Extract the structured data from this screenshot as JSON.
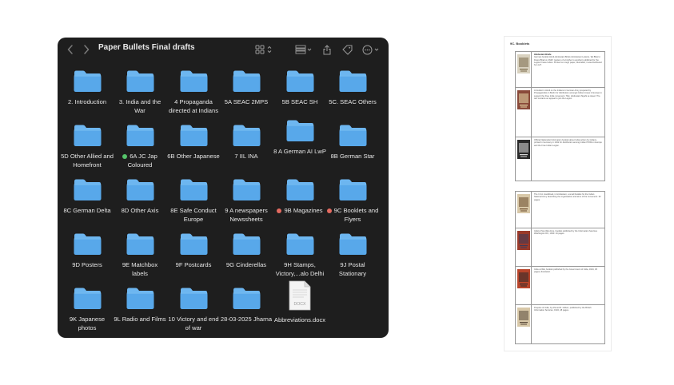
{
  "window": {
    "title": "Paper Bullets Final drafts"
  },
  "colors": {
    "folder_top": "#6db6f0",
    "folder_body": "#58a8ea",
    "window_bg": "#1e1e1e",
    "tag_green": "#55c46a",
    "tag_red": "#e36a60"
  },
  "toolbar": {
    "back_icon": "chevron-left-icon",
    "forward_icon": "chevron-right-icon",
    "view_icon": "grid-view-icon",
    "group_icon": "group-by-icon",
    "share_icon": "share-icon",
    "tag_icon": "tag-icon",
    "more_icon": "more-icon"
  },
  "items": [
    {
      "label": "2. Introduction",
      "type": "folder",
      "tag": ""
    },
    {
      "label": "3. India and the War",
      "type": "folder",
      "tag": ""
    },
    {
      "label": "4 Propaganda directed at Indians",
      "type": "folder",
      "tag": ""
    },
    {
      "label": "5A SEAC 2MPS",
      "type": "folder",
      "tag": ""
    },
    {
      "label": "5B SEAC SH",
      "type": "folder",
      "tag": ""
    },
    {
      "label": "5C. SEAC Others",
      "type": "folder",
      "tag": ""
    },
    {
      "label": "5D Other Allied and Homefront",
      "type": "folder",
      "tag": ""
    },
    {
      "label": "6A JC Jap Coloured",
      "type": "folder",
      "tag": "green"
    },
    {
      "label": "6B Other Japanese",
      "type": "folder",
      "tag": ""
    },
    {
      "label": "7 IIL INA",
      "type": "folder",
      "tag": ""
    },
    {
      "label": "8 A German AI LwP",
      "type": "folder",
      "tag": ""
    },
    {
      "label": "8B German Star",
      "type": "folder",
      "tag": ""
    },
    {
      "label": "8C German Delta",
      "type": "folder",
      "tag": ""
    },
    {
      "label": "8D Other Axis",
      "type": "folder",
      "tag": ""
    },
    {
      "label": "8E Safe Conduct Europe",
      "type": "folder",
      "tag": ""
    },
    {
      "label": "9 A newspapers Newssheets",
      "type": "folder",
      "tag": ""
    },
    {
      "label": "9B Magazines",
      "type": "folder",
      "tag": "red"
    },
    {
      "label": "9C Booklets and Flyers",
      "type": "folder",
      "tag": "red"
    },
    {
      "label": "9D Posters",
      "type": "folder",
      "tag": ""
    },
    {
      "label": "9E Matchbox labels",
      "type": "folder",
      "tag": ""
    },
    {
      "label": "9F Postcards",
      "type": "folder",
      "tag": ""
    },
    {
      "label": "9G Cinderellas",
      "type": "folder",
      "tag": ""
    },
    {
      "label": "9H Stamps, Victory,...alo Delhi",
      "type": "folder",
      "tag": ""
    },
    {
      "label": "9J Postal Stationary",
      "type": "folder",
      "tag": ""
    },
    {
      "label": "9K Japanese photos",
      "type": "folder",
      "tag": ""
    },
    {
      "label": "9L Radio and Films",
      "type": "folder",
      "tag": ""
    },
    {
      "label": "10 Victory and end of war",
      "type": "folder",
      "tag": ""
    },
    {
      "label": "28-03-2025 Jharna",
      "type": "folder",
      "tag": ""
    },
    {
      "label": "Abbreviations.docx",
      "type": "docx",
      "tag": "",
      "badge": "DOCX"
    }
  ],
  "doc_preview": {
    "heading": "9C. Booklets",
    "rows_top": [
      {
        "title": "Hindustani Briefe",
        "text": "German booklet Hindi-Hindustani Briefe (Hindustani Letters), 'Ek Bhai ki Dusre Bhai ko Chithi' (Letters of a brother to another) published for the Legion Freies Indien. Printed on rough paper, illustrated, it was distributed by Lw.P.",
        "highlight": ""
      },
      {
        "title": "",
        "text": "A booklet in Hindi on the Indians in German Army prepared by Propagandists in Berlin for distribution amongst Indian troops in Europe to support the Free India movement. Title: Hindustani Sipahi se Apeel. The text contains an appeal to join the Legion.",
        "highlight": ""
      },
      {
        "title": "",
        "text": "Official Nationalist Information booklet about India written by Indians, printed in Germany in 1942 for distribution among Indian POWs in Europe and the Free Indian Legion.",
        "highlight": ""
      }
    ],
    "rows_bottom": [
      {
        "title": "",
        "text": "The I.N.A. Handbook, in Hindustani, a small booklet for the Indian National Army describing the organisation and aims of the movement. 32 pages.",
        "highlight": ""
      },
      {
        "title": "",
        "text": "India's Post-War Aims, booklet published by the Information Services Washington DC, 1943. 24 pages.",
        "highlight": ""
      },
      {
        "title": "",
        "text": "India at War, booklet published by the Government of India, 1944, 36 pages, illustrated.",
        "highlight": ""
      },
      {
        "title": "",
        "text": "Peoples of India, by Ahmed R. Gilbert, published by the British Information Services, 1943, 48 pages.",
        "highlight": ""
      }
    ]
  }
}
